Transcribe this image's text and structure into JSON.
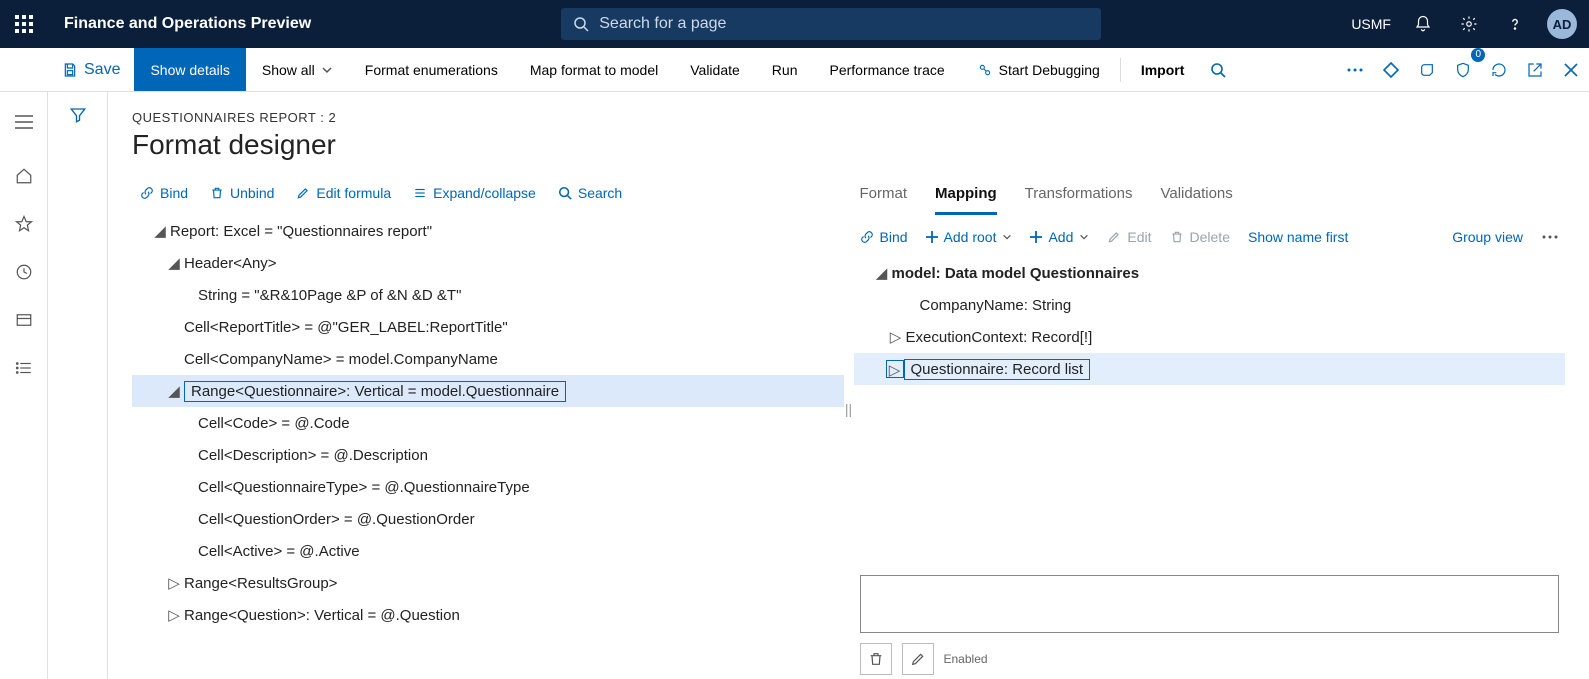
{
  "topbar": {
    "app_title": "Finance and Operations Preview",
    "search_placeholder": "Search for a page",
    "company": "USMF",
    "avatar_initials": "AD"
  },
  "cmdbar": {
    "save": "Save",
    "show_details": "Show details",
    "show_all": "Show all",
    "format_enumerations": "Format enumerations",
    "map_format": "Map format to model",
    "validate": "Validate",
    "run": "Run",
    "perf_trace": "Performance trace",
    "start_debugging": "Start Debugging",
    "import": "Import",
    "badge_count": "0"
  },
  "page": {
    "breadcrumb": "QUESTIONNAIRES REPORT : 2",
    "title": "Format designer"
  },
  "left_toolbar": {
    "bind": "Bind",
    "unbind": "Unbind",
    "edit_formula": "Edit formula",
    "expand_collapse": "Expand/collapse",
    "search": "Search"
  },
  "left_tree": {
    "n0": "Report: Excel = \"Questionnaires report\"",
    "n1": "Header<Any>",
    "n2": "String = \"&R&10Page &P of &N &D &T\"",
    "n3": "Cell<ReportTitle> = @\"GER_LABEL:ReportTitle\"",
    "n4": "Cell<CompanyName> = model.CompanyName",
    "n5": "Range<Questionnaire>: Vertical = model.Questionnaire",
    "n6": "Cell<Code> = @.Code",
    "n7": "Cell<Description> = @.Description",
    "n8": "Cell<QuestionnaireType> = @.QuestionnaireType",
    "n9": "Cell<QuestionOrder> = @.QuestionOrder",
    "n10": "Cell<Active> = @.Active",
    "n11": "Range<ResultsGroup>",
    "n12": "Range<Question>: Vertical = @.Question"
  },
  "right_tabs": {
    "format": "Format",
    "mapping": "Mapping",
    "transformations": "Transformations",
    "validations": "Validations"
  },
  "right_toolbar": {
    "bind": "Bind",
    "add_root": "Add root",
    "add": "Add",
    "edit": "Edit",
    "delete": "Delete",
    "show_name_first": "Show name first",
    "group_view": "Group view"
  },
  "right_tree": {
    "m0": "model: Data model Questionnaires",
    "m1": "CompanyName: String",
    "m2": "ExecutionContext: Record[!]",
    "m3": "Questionnaire: Record list"
  },
  "footer": {
    "enabled": "Enabled"
  }
}
